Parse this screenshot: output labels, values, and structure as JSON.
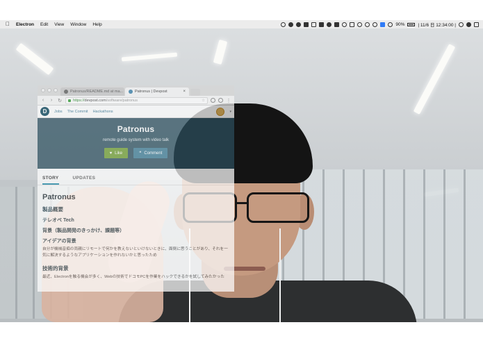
{
  "menubar": {
    "app_name": "Electron",
    "menus": [
      "Edit",
      "View",
      "Window",
      "Help"
    ],
    "battery": "90%",
    "clock": "| 11/6 日 12:34:00 |"
  },
  "browser": {
    "tabs": [
      {
        "title": "Patronus/README.md at ma..."
      },
      {
        "title": "Patronus | Devpost"
      }
    ],
    "url_scheme": "https://",
    "url_host": "devpost.com",
    "url_path": "/software/patronus"
  },
  "site_nav": {
    "logo_letter": "D",
    "links": [
      "Jobs",
      "The Commit",
      "Hackathons"
    ]
  },
  "project": {
    "title": "Patronus",
    "tagline": "remote guide system with video talk",
    "like_label": "Like",
    "comment_label": "Comment"
  },
  "content_tabs": [
    "STORY",
    "UPDATES"
  ],
  "story": {
    "heading": "Patronus",
    "section_overview": "製品概要",
    "subsection_tech": "テレオペ Tech",
    "subsection_background": "背景（製品開発のきっかけ、課題等）",
    "subsection_idea": "アイデアの背景",
    "idea_text": "自分が機械音痴の両親にリモートで何かを教えないといけないときに、面倒に思うことがあり、それを一気に解決するようなアプリケーションを作れないかと思ったため",
    "section_tech_background": "技術的背景",
    "tech_text": "最近、Electronを触る機会が多く、Webの技術でドコモPCを作業をハックできるかを試してみたかった"
  },
  "colors": {
    "hero_bg": "#2c4f5e",
    "like_button": "#6e9e2f",
    "comment_button": "#3c7b94",
    "active_tab_underline": "#1c8aa9"
  }
}
